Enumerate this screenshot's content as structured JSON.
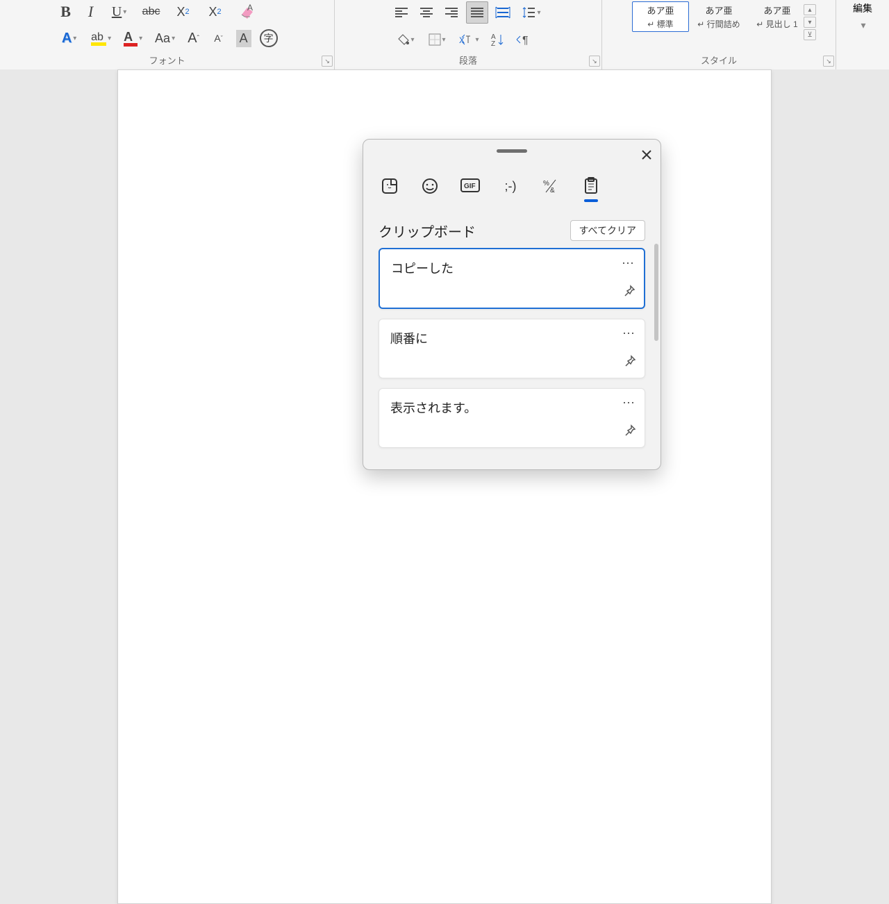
{
  "ribbon": {
    "font": {
      "label": "フォント"
    },
    "paragraph": {
      "label": "段落"
    },
    "styles": {
      "label": "スタイル",
      "items": [
        {
          "preview": "あア亜",
          "name": "標準",
          "selected": true
        },
        {
          "preview": "あア亜",
          "name": "行間詰め",
          "selected": false
        },
        {
          "preview": "あア亜",
          "name": "見出し 1",
          "selected": false
        }
      ]
    },
    "edit": {
      "label": "編集"
    }
  },
  "panel": {
    "title": "クリップボード",
    "clear_all": "すべてクリア",
    "tabs": [
      "sticker",
      "emoji",
      "gif",
      "kaomoji",
      "symbol",
      "clipboard"
    ],
    "active_tab": 5,
    "items": [
      {
        "text": "コピーした",
        "selected": true
      },
      {
        "text": "順番に",
        "selected": false
      },
      {
        "text": "表示されます。",
        "selected": false
      }
    ]
  }
}
